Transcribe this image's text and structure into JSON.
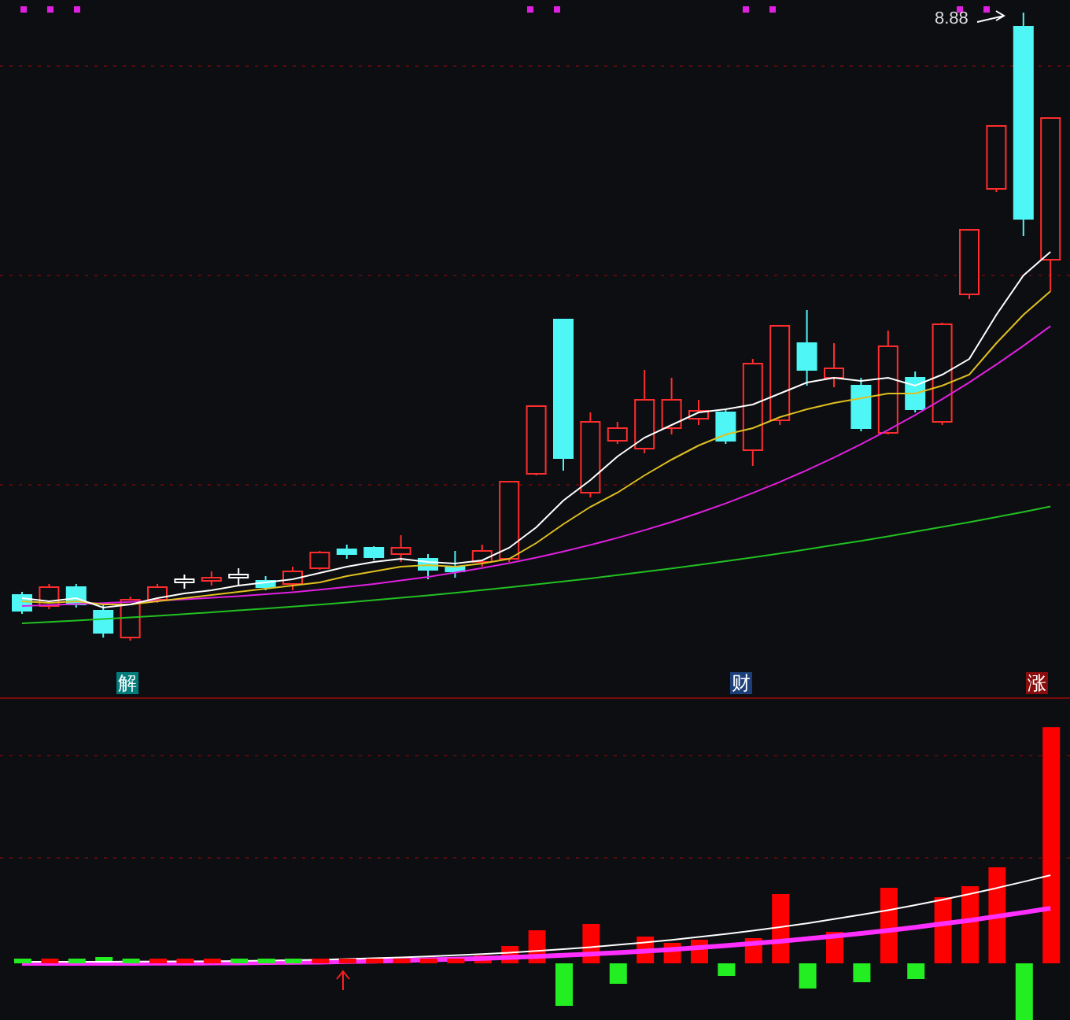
{
  "price_chart": {
    "high_price_label": "8.88"
  },
  "signal_markers": [
    {
      "text": "解",
      "color": "#007c7c"
    },
    {
      "text": "财",
      "color": "#1c3f7a"
    },
    {
      "text": "涨",
      "color": "#8a0d0d"
    }
  ]
}
